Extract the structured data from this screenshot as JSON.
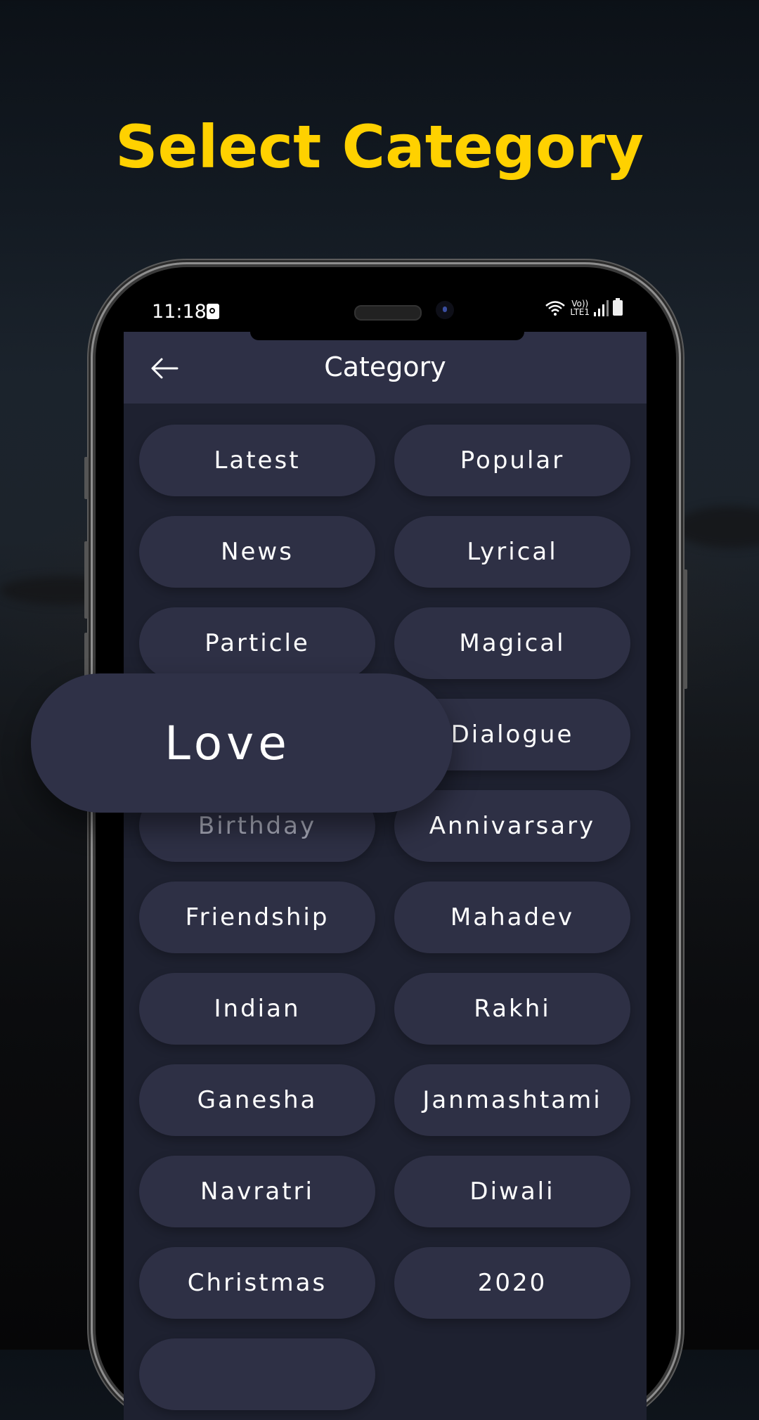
{
  "promo": {
    "title": "Select Category"
  },
  "status_bar": {
    "time": "11:18",
    "network_label_top": "Vo))",
    "network_label_bottom": "LTE1"
  },
  "app_bar": {
    "title": "Category",
    "back_icon": "arrow-left-icon"
  },
  "categories": [
    "Latest",
    "Popular",
    "News",
    "Lyrical",
    "Particle",
    "Magical",
    "Love",
    "Dialogue",
    "Birthday",
    "Annivarsary",
    "Friendship",
    "Mahadev",
    "Indian",
    "Rakhi",
    "Ganesha",
    "Janmashtami",
    "Navratri",
    "Diwali",
    "Christmas",
    "2020",
    ""
  ],
  "highlighted_category": "Love",
  "colors": {
    "title_yellow": "#ffd100",
    "app_bar_bg": "#2e3046",
    "screen_bg": "#1e2130",
    "chip_bg": "#2e3045"
  }
}
